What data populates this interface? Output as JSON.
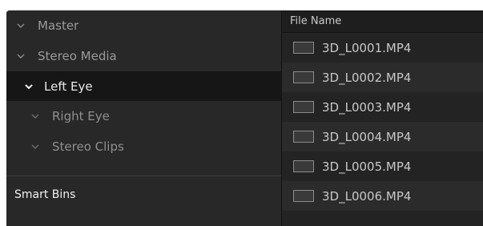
{
  "bins": {
    "items": [
      {
        "label": "Master",
        "icon": "chevron-down-icon",
        "selected": false
      },
      {
        "label": "Stereo Media",
        "icon": "chevron-down-icon",
        "selected": false
      },
      {
        "label": "Left Eye",
        "icon": "chevron-down-icon",
        "selected": true
      },
      {
        "label": "Right Eye",
        "icon": "chevron-down-icon",
        "selected": false
      },
      {
        "label": "Stereo Clips",
        "icon": "chevron-down-icon",
        "selected": false
      }
    ],
    "smart_bins_label": "Smart Bins"
  },
  "files": {
    "header": "File Name",
    "rows": [
      {
        "name": "3D_L0001.MP4",
        "icon": "video-clip-icon"
      },
      {
        "name": "3D_L0002.MP4",
        "icon": "video-clip-icon"
      },
      {
        "name": "3D_L0003.MP4",
        "icon": "video-clip-icon"
      },
      {
        "name": "3D_L0004.MP4",
        "icon": "video-clip-icon"
      },
      {
        "name": "3D_L0005.MP4",
        "icon": "video-clip-icon"
      },
      {
        "name": "3D_L0006.MP4",
        "icon": "video-clip-icon"
      }
    ]
  },
  "colors": {
    "panel_bg": "#282828",
    "selected_bg": "#161616",
    "file_list_bg": "#232323",
    "file_row_alt_bg": "#2b2b2b"
  }
}
